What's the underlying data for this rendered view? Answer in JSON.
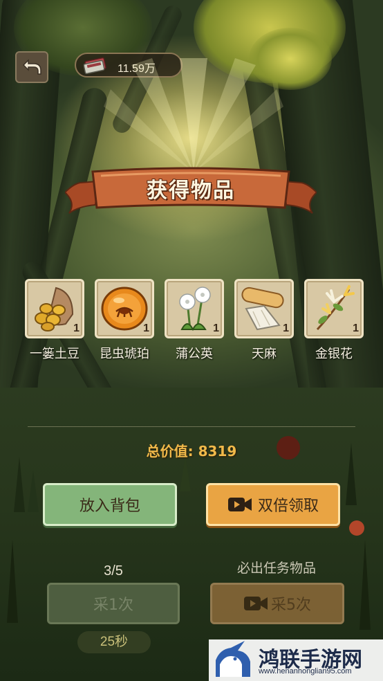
{
  "header": {
    "currency_value": "11.59万"
  },
  "banner": {
    "title": "获得物品"
  },
  "items": [
    {
      "name": "一篓土豆",
      "qty": "1",
      "icon": "potato-basket-icon"
    },
    {
      "name": "昆虫琥珀",
      "qty": "1",
      "icon": "insect-amber-icon"
    },
    {
      "name": "蒲公英",
      "qty": "1",
      "icon": "dandelion-icon"
    },
    {
      "name": "天麻",
      "qty": "1",
      "icon": "gastrodia-root-icon"
    },
    {
      "name": "金银花",
      "qty": "1",
      "icon": "honeysuckle-icon"
    }
  ],
  "total": {
    "label": "总价值:",
    "value": "8319"
  },
  "buttons": {
    "put_in_bag": "放入背包",
    "double_claim": "双倍领取",
    "gather_once": "采1次",
    "gather_five": "采5次"
  },
  "gather": {
    "progress": "3/5",
    "must_drop_label": "必出任务物品",
    "timer": "25秒"
  },
  "watermark": {
    "text": "鸿联手游网",
    "url": "www.henanhonglian95.com"
  },
  "colors": {
    "banner": "#c8693a",
    "green_button": "#84b57a",
    "orange_button": "#e9a443",
    "total_text": "#f0b94a"
  }
}
